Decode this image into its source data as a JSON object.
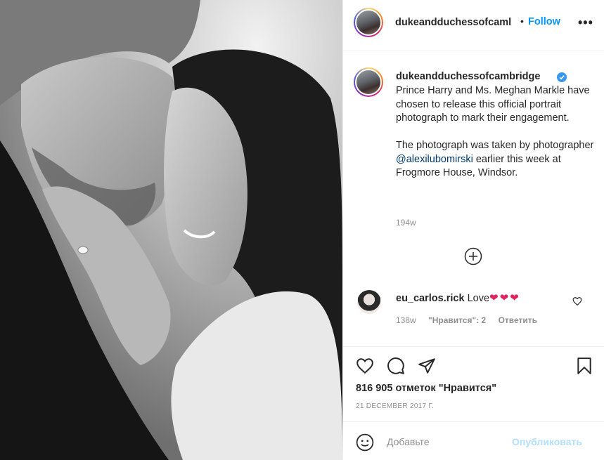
{
  "post": {
    "username": "dukeandduchessofcambridge",
    "header_username": "dukeandduchessofcaml",
    "dot": "•",
    "follow_label": "Follow",
    "more_label": "•••",
    "caption_line_1": "Prince Harry and Ms. Meghan Markle have chosen to release this official portrait photograph to mark their engagement.",
    "caption_line_2_pre": "The photograph was taken by photographer ",
    "caption_mention": "@alexilubomirski",
    "caption_line_2_post": " earlier this week at Frogmore House, Windsor.",
    "caption_time": "194w"
  },
  "comment": {
    "username": "eu_carlos.rick",
    "text": "Love",
    "hearts": "❤❤❤",
    "time": "138w",
    "likes": "\"Нравится\": 2",
    "reply_label": "Ответить"
  },
  "stats": {
    "likes": "816 905 отметок \"Нравится\"",
    "date": "21 DECEMBER 2017 Г."
  },
  "add_comment": {
    "placeholder": "Добавьте",
    "post_label": "Опубликовать"
  },
  "icons": [
    "heart-icon",
    "comment-icon",
    "share-icon",
    "bookmark-icon",
    "emoji-icon",
    "plus-circle-icon",
    "verified-badge-icon",
    "more-icon"
  ],
  "colors": {
    "follow": "#0095f6",
    "mention": "#00376b",
    "muted": "#8e8e8e",
    "hearts": "#e0245e",
    "post_disabled": "#b2dffc"
  }
}
